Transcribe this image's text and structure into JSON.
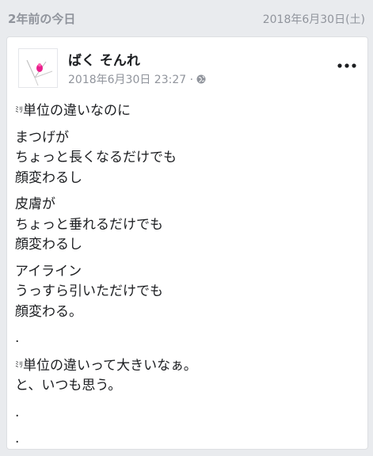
{
  "memory_header": {
    "label": "2年前の今日",
    "date": "2018年6月30日(土)"
  },
  "post": {
    "author": "ばく そんれ",
    "timestamp": "2018年6月30日 23:27 · ",
    "privacy_icon": "globe-icon",
    "more_icon": "more-horizontal-icon",
    "paragraphs": [
      {
        "small_prefix": "ﾐﾘ",
        "lines": [
          "単位の違いなのに"
        ]
      },
      {
        "lines": [
          "まつげが",
          "ちょっと長くなるだけでも",
          "顔変わるし"
        ]
      },
      {
        "lines": [
          "皮膚が",
          "ちょっと垂れるだけでも",
          "顔変わるし"
        ]
      },
      {
        "lines": [
          "アイライン",
          "うっすら引いただけでも",
          "顔変わる。"
        ]
      },
      {
        "lines": [
          "."
        ]
      },
      {
        "small_prefix": "ﾐﾘ",
        "lines": [
          "単位の違いって大きいなぁ。",
          "と、いつも思う。"
        ]
      },
      {
        "lines": [
          "."
        ]
      },
      {
        "lines": [
          "."
        ]
      }
    ]
  },
  "colors": {
    "background": "#e9ebee",
    "card": "#ffffff",
    "muted": "#90949c",
    "text": "#1c1e21",
    "avatar_accent": "#e91e8c"
  }
}
